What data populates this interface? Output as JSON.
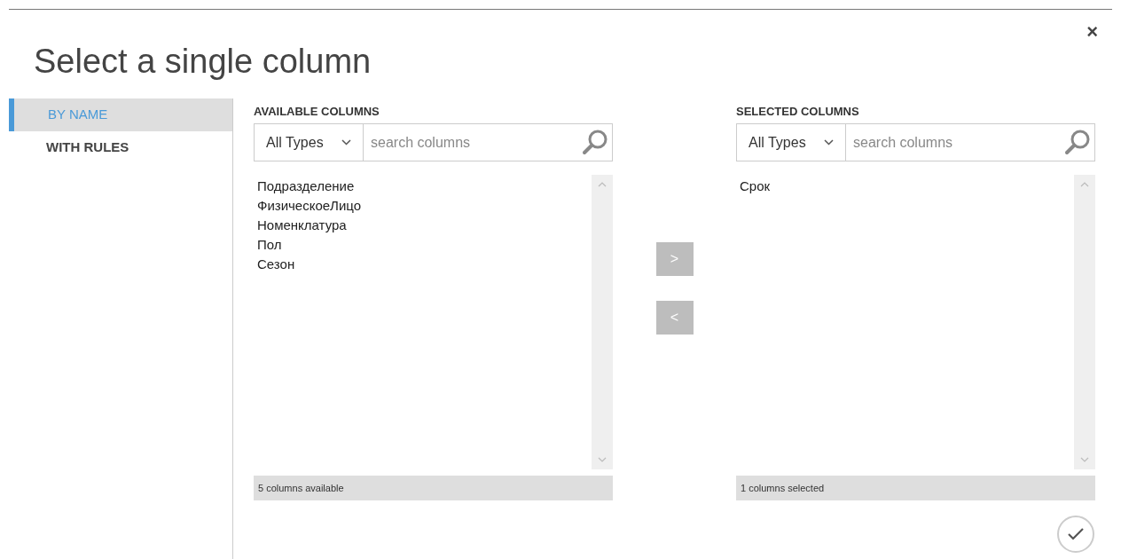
{
  "dialog": {
    "title": "Select a single column",
    "close": "×"
  },
  "tabs": [
    {
      "label": "BY NAME",
      "selected": true
    },
    {
      "label": "WITH RULES",
      "selected": false
    }
  ],
  "available": {
    "heading": "AVAILABLE COLUMNS",
    "type_filter": "All Types",
    "search": {
      "placeholder": "search columns"
    },
    "items": [
      "Подразделение",
      "ФизическоеЛицо",
      "Номенклатура",
      "Пол",
      "Сезон"
    ],
    "footer": "5 columns available"
  },
  "move_buttons": [
    ">",
    "<"
  ],
  "selected": {
    "heading": "SELECTED COLUMNS",
    "type_filter": "All Types",
    "search": {
      "placeholder": "search columns"
    },
    "items": [
      "Срок"
    ],
    "footer": "1 columns selected"
  }
}
